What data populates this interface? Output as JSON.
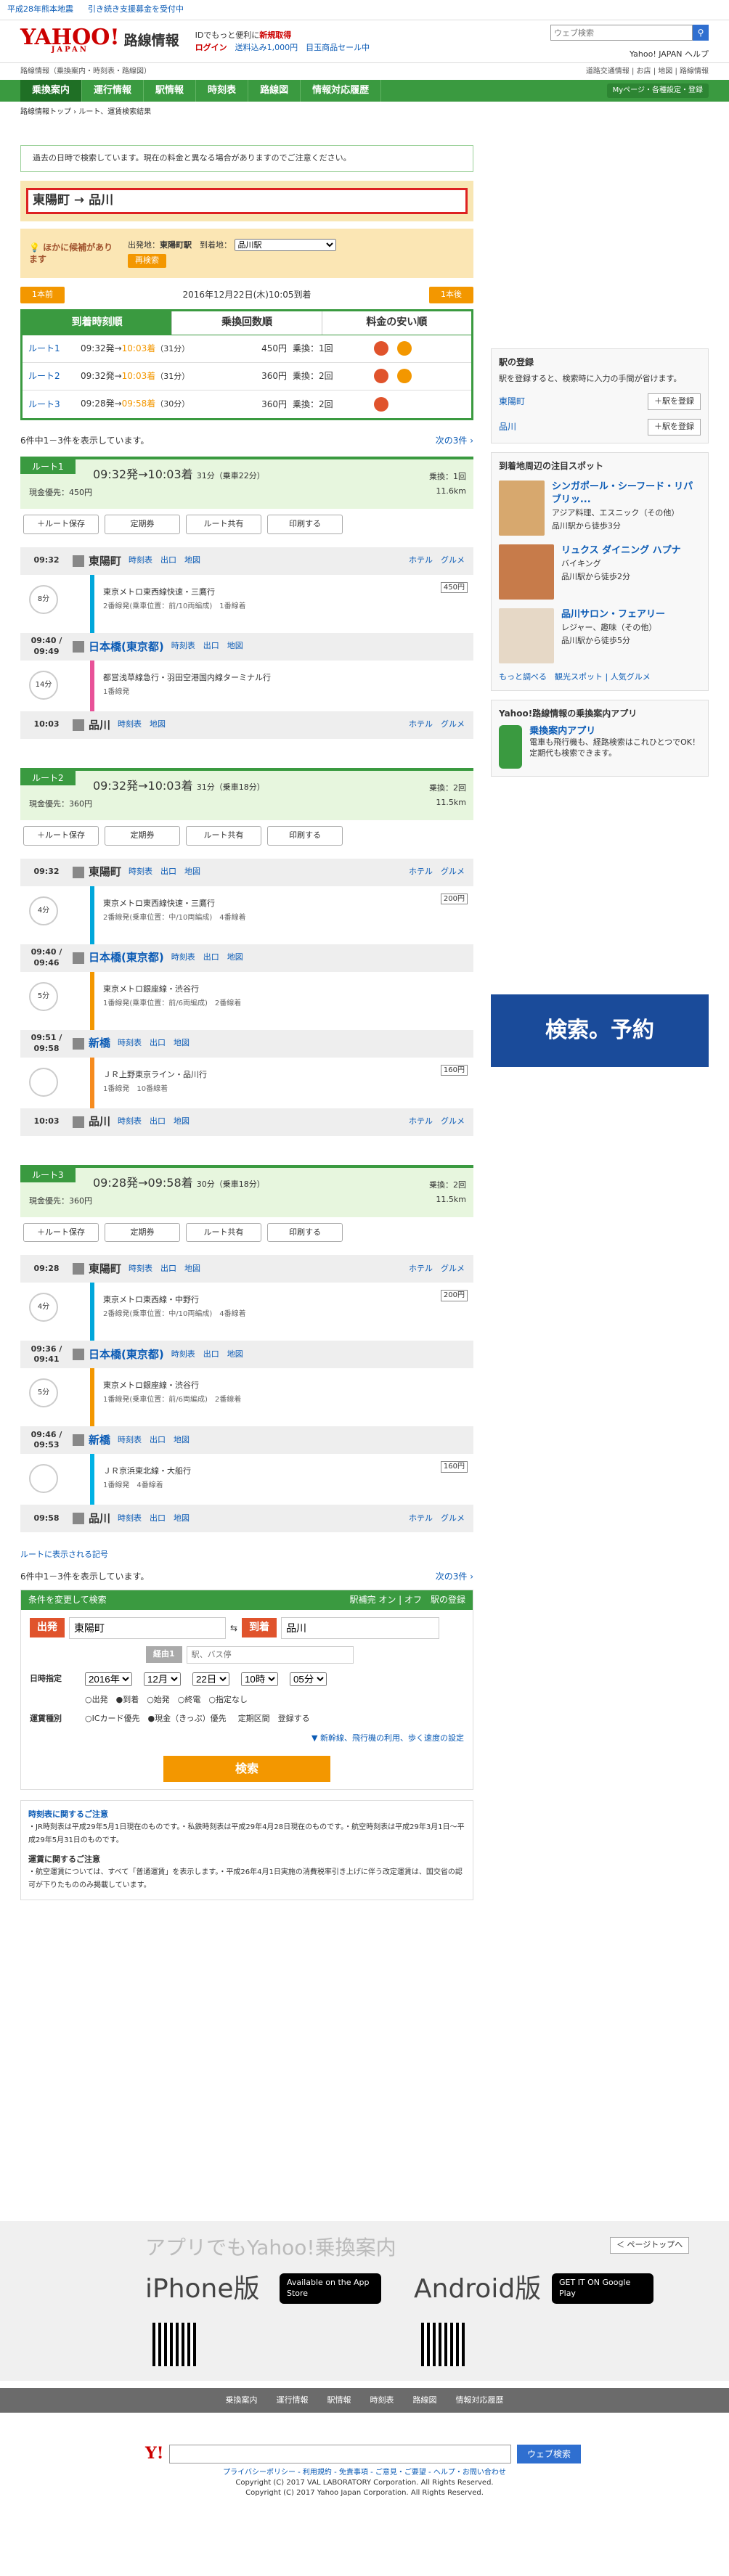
{
  "top": {
    "notice1": "平成28年熊本地震",
    "notice2": "引き続き支援募金を受付中"
  },
  "header": {
    "logo": "YAHOO!",
    "logo_sub": "JAPAN",
    "service": "路線情報",
    "promo1": "IDでもっと便利に",
    "promo2": "新規取得",
    "login": "ログイン",
    "promo3": "送料込み1,000円　目玉商品セール中",
    "search_placeholder": "ウェブ検索",
    "links": "Yahoo! JAPAN ヘルプ"
  },
  "bc1": {
    "left": "路線情報（乗換案内・時刻表・路線図）",
    "right": "道路交通情報 | お店 | 地図 | 路線情報"
  },
  "nav": {
    "items": [
      "乗換案内",
      "運行情報",
      "駅情報",
      "時刻表",
      "路線図",
      "情報対応履歴"
    ],
    "mypage": "Myページ・各種設定・登録"
  },
  "bc2": "路線情報トップ › ルート、運賃検索結果",
  "past": "過去の日時で検索しています。現在の料金と異なる場合がありますのでご注意ください。",
  "od": "東陽町 → 品川",
  "cand": {
    "q": "ほかに候補があります",
    "from_l": "出発地：",
    "from": "東陽町駅",
    "to_l": "到着地：",
    "to": "品川駅",
    "btn": "再検索"
  },
  "date": {
    "prev": "1本前",
    "text": "2016年12月22日(木)10:05到着",
    "next": "1本後"
  },
  "tabs": [
    "到着時刻順",
    "乗換回数順",
    "料金の安い順"
  ],
  "summary": [
    {
      "label": "ルート1",
      "dep": "09:32発",
      "arr": "10:03着",
      "dur": "（31分）",
      "fare": "450円",
      "xfer": "乗換：1回"
    },
    {
      "label": "ルート2",
      "dep": "09:32発",
      "arr": "10:03着",
      "dur": "（31分）",
      "fare": "360円",
      "xfer": "乗換：2回"
    },
    {
      "label": "ルート3",
      "dep": "09:28発",
      "arr": "09:58着",
      "dur": "（30分）",
      "fare": "360円",
      "xfer": "乗換：2回"
    }
  ],
  "count": {
    "text": "6件中1－3件を表示しています。",
    "next": "次の3件 ›"
  },
  "actions": [
    "＋ルート保存",
    "定期券",
    "ルート共有",
    "印刷する"
  ],
  "routes": [
    {
      "label": "ルート1",
      "time": "09:32発→10:03着",
      "dur": "31分（乗車22分）",
      "xfer": "乗換：1回",
      "fare": "現金優先：450円",
      "dist": "11.6km",
      "stations": [
        {
          "t": "09:32",
          "n": "東陽町",
          "l": "時刻表　出口　地図",
          "r": "ホテル　グルメ"
        },
        {
          "t": "09:40 / 09:49",
          "n": "日本橋(東京都)",
          "l": "時刻表　出口　地図",
          "r": ""
        },
        {
          "t": "10:03",
          "n": "品川",
          "l": "時刻表　地図",
          "r": "ホテル　グルメ"
        }
      ],
      "legs": [
        {
          "line": "東京メトロ東西線快速・三鷹行",
          "sub": "2番線発(乗車位置：前/10両編成)　1番線着",
          "fare": "450円",
          "min": "8分",
          "col": "#00a7db"
        },
        {
          "line": "都営浅草線急行・羽田空港国内線ターミナル行",
          "sub": "1番線発",
          "fare": "",
          "min": "14分",
          "col": "#e85298"
        }
      ]
    },
    {
      "label": "ルート2",
      "time": "09:32発→10:03着",
      "dur": "31分（乗車18分）",
      "xfer": "乗換：2回",
      "fare": "現金優先：360円",
      "dist": "11.5km",
      "stations": [
        {
          "t": "09:32",
          "n": "東陽町",
          "l": "時刻表　出口　地図",
          "r": "ホテル　グルメ"
        },
        {
          "t": "09:40 / 09:46",
          "n": "日本橋(東京都)",
          "l": "時刻表　出口　地図",
          "r": ""
        },
        {
          "t": "09:51 / 09:58",
          "n": "新橋",
          "l": "時刻表　出口　地図",
          "r": ""
        },
        {
          "t": "10:03",
          "n": "品川",
          "l": "時刻表　出口　地図",
          "r": "ホテル　グルメ"
        }
      ],
      "legs": [
        {
          "line": "東京メトロ東西線快速・三鷹行",
          "sub": "2番線発(乗車位置：中/10両編成)　4番線着",
          "fare": "200円",
          "min": "4分",
          "col": "#00a7db"
        },
        {
          "line": "東京メトロ銀座線・渋谷行",
          "sub": "1番線発(乗車位置：前/6両編成)　2番線着",
          "fare": "",
          "min": "5分",
          "col": "#f39700"
        },
        {
          "line": "ＪＲ上野東京ライン・品川行",
          "sub": "1番線発　10番線着",
          "fare": "160円",
          "min": "",
          "col": "#f68b1e"
        }
      ]
    },
    {
      "label": "ルート3",
      "time": "09:28発→09:58着",
      "dur": "30分（乗車18分）",
      "xfer": "乗換：2回",
      "fare": "現金優先：360円",
      "dist": "11.5km",
      "stations": [
        {
          "t": "09:28",
          "n": "東陽町",
          "l": "時刻表　出口　地図",
          "r": "ホテル　グルメ"
        },
        {
          "t": "09:36 / 09:41",
          "n": "日本橋(東京都)",
          "l": "時刻表　出口　地図",
          "r": ""
        },
        {
          "t": "09:46 / 09:53",
          "n": "新橋",
          "l": "時刻表　出口　地図",
          "r": ""
        },
        {
          "t": "09:58",
          "n": "品川",
          "l": "時刻表　出口　地図",
          "r": "ホテル　グルメ"
        }
      ],
      "legs": [
        {
          "line": "東京メトロ東西線・中野行",
          "sub": "2番線発(乗車位置：中/10両編成)　4番線着",
          "fare": "200円",
          "min": "4分",
          "col": "#00a7db"
        },
        {
          "line": "東京メトロ銀座線・渋谷行",
          "sub": "1番線発(乗車位置：前/6両編成)　2番線着",
          "fare": "",
          "min": "5分",
          "col": "#f39700"
        },
        {
          "line": "ＪＲ京浜東北線・大船行",
          "sub": "1番線発　4番線着",
          "fare": "160円",
          "min": "",
          "col": "#00b2e5"
        }
      ]
    }
  ],
  "legend": "ルートに表示される記号",
  "count2": {
    "text": "6件中1－3件を表示しています。",
    "next": "次の3件 ›"
  },
  "cond": {
    "title": "条件を変更して検索",
    "right": "駅補完 オン | オフ　駅の登録",
    "from_l": "出発",
    "from": "東陽町",
    "to_l": "到着",
    "to": "品川",
    "via_l": "経由1",
    "via_ph": "駅、バス停",
    "dt_l": "日時指定",
    "year": "2016年",
    "month": "12月",
    "day": "22日",
    "hour": "10時",
    "min": "05分",
    "modes": "○出発　●到着　○始発　○終電　○指定なし",
    "fare_l": "運賃種別",
    "fare_opts": "○ICカード優先　●現金（きっぷ）優先",
    "teiki": "定期区間　登録する",
    "more": "▼ 新幹線、飛行機の利用、歩く速度の設定",
    "btn": "検索"
  },
  "notes": {
    "h1": "時刻表に関するご注意",
    "t1": "・JR時刻表は平成29年5月1日現在のものです。・私鉄時刻表は平成29年4月28日現在のものです。・航空時刻表は平成29年3月1日～平成29年5月31日のものです。",
    "h2": "運賃に関するご注意",
    "t2": "・航空運賃については、すべて「普通運賃」を表示します。・平成26年4月1日実施の消費税率引き上げに伴う改定運賃は、国交省の認可が下りたもののみ掲載しています。"
  },
  "side": {
    "reg_title": "駅の登録",
    "reg_text": "駅を登録すると、検索時に入力の手間が省けます。",
    "reg": [
      {
        "n": "東陽町",
        "b": "＋駅を登録"
      },
      {
        "n": "品川",
        "b": "＋駅を登録"
      }
    ],
    "spot_title": "到着地周辺の注目スポット",
    "spots": [
      {
        "n": "シンガポール・シーフード・リパブリッ...",
        "c": "アジア料理、エスニック（その他）",
        "w": "品川駅から徒歩3分",
        "col": "#d7a86e"
      },
      {
        "n": "リュクス ダイニング ハプナ",
        "c": "バイキング",
        "w": "品川駅から徒歩2分",
        "col": "#c77b4a"
      },
      {
        "n": "品川サロン・フェアリー",
        "c": "レジャー、趣味（その他）",
        "w": "品川駅から徒歩5分",
        "col": "#e6d8c6"
      }
    ],
    "spot_more": "もっと調べる　観光スポット | 人気グルメ",
    "app_title": "Yahoo!路線情報の乗換案内アプリ",
    "app_name": "乗換案内アプリ",
    "app_text": "電車も飛行機も、経路検索はこれひとつでOK！　定期代も検索できます。",
    "ad": "検索。予約"
  },
  "footer": {
    "app_head": "アプリでもYahoo!乗換案内",
    "iphone": "iPhone版",
    "android": "Android版",
    "appstore": "Available on the App Store",
    "gplay": "GET IT ON Google Play",
    "pagetop": "＜ ページトップへ",
    "nav": [
      "乗換案内",
      "運行情報",
      "駅情報",
      "時刻表",
      "路線図",
      "情報対応履歴"
    ],
    "search_btn": "ウェブ検索",
    "copy1": "プライバシーポリシー - 利用規約 - 免責事項 - ご意見・ご要望 - ヘルプ・お問い合わせ",
    "copy2": "Copyright (C) 2017 VAL LABORATORY Corporation. All Rights Reserved.",
    "copy3": "Copyright (C) 2017 Yahoo Japan Corporation. All Rights Reserved."
  }
}
